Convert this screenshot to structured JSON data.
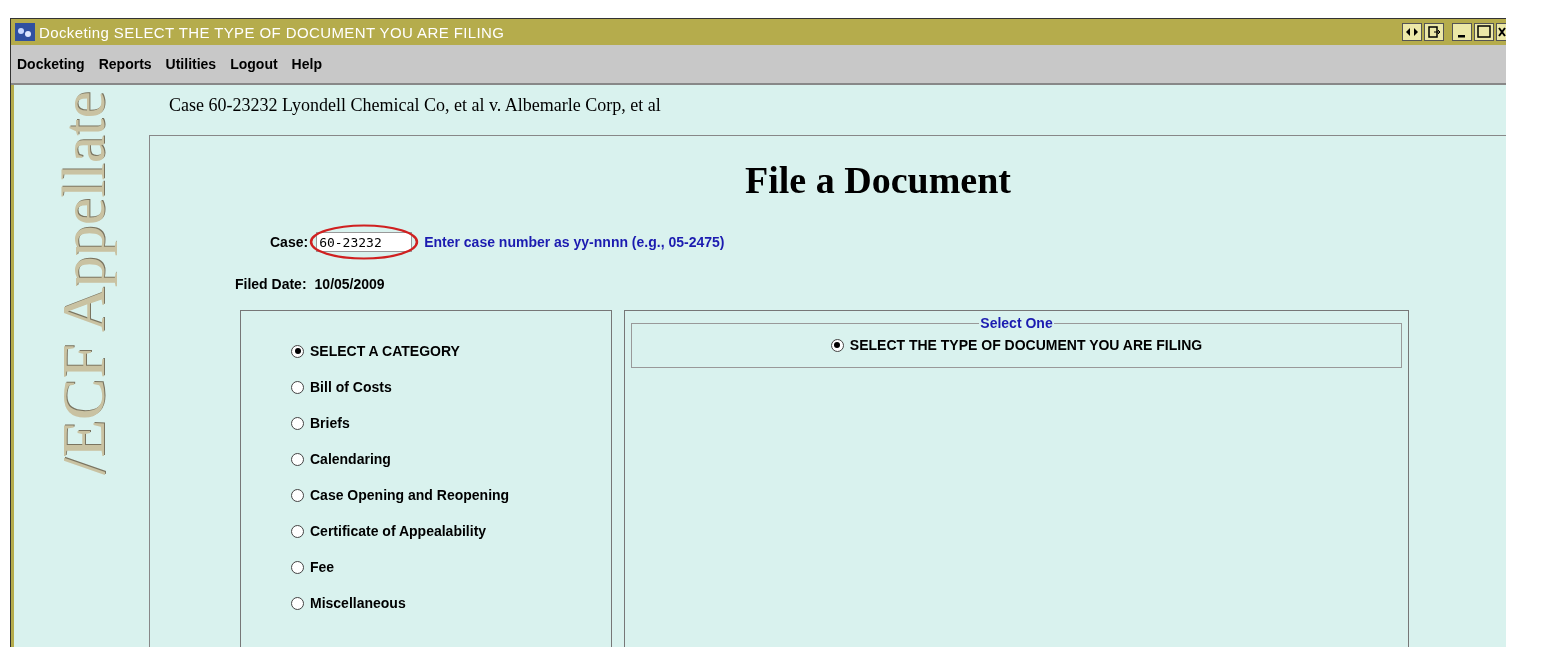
{
  "window": {
    "title": "Docketing SELECT THE TYPE OF DOCUMENT YOU ARE FILING"
  },
  "menu": [
    "Docketing",
    "Reports",
    "Utilities",
    "Logout",
    "Help"
  ],
  "side_banner": "/ECF Appellate",
  "case_heading": "Case 60-23232 Lyondell Chemical Co, et al v. Albemarle Corp, et al",
  "form": {
    "title": "File a Document",
    "case_label": "Case:",
    "case_value": "60-23232",
    "case_hint": "Enter case number as yy-nnnn (e.g., 05-2475)",
    "filed_label": "Filed Date:",
    "filed_value": "10/05/2009"
  },
  "categories": [
    {
      "label": "SELECT A CATEGORY",
      "selected": true
    },
    {
      "label": "Bill of Costs",
      "selected": false
    },
    {
      "label": "Briefs",
      "selected": false
    },
    {
      "label": "Calendaring",
      "selected": false
    },
    {
      "label": "Case Opening and Reopening",
      "selected": false
    },
    {
      "label": "Certificate of Appealability",
      "selected": false
    },
    {
      "label": "Fee",
      "selected": false
    },
    {
      "label": "Miscellaneous",
      "selected": false
    }
  ],
  "document_type": {
    "legend": "Select One",
    "options": [
      {
        "label": "SELECT THE TYPE OF DOCUMENT YOU ARE FILING",
        "selected": true
      }
    ]
  }
}
